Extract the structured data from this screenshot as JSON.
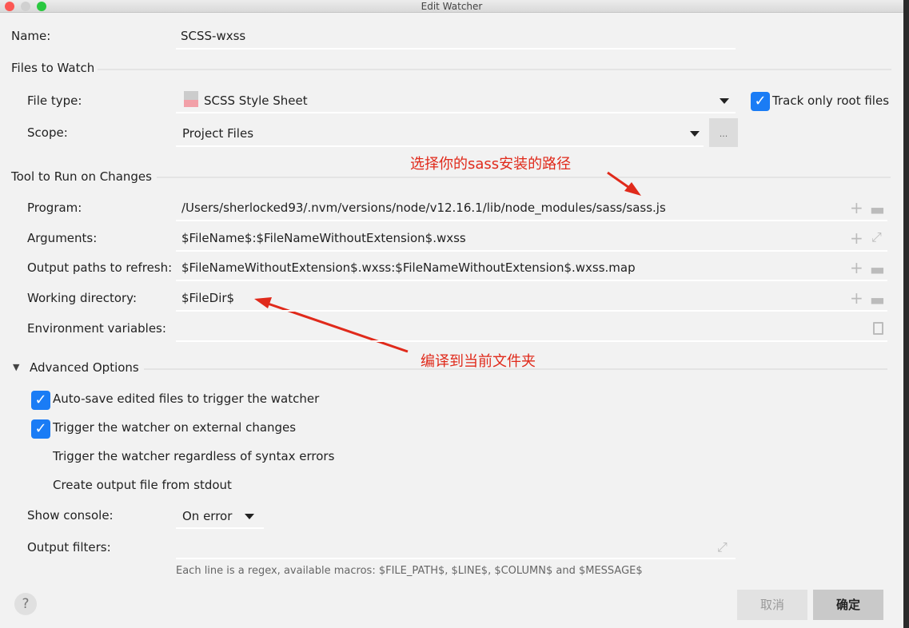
{
  "window": {
    "title": "Edit Watcher"
  },
  "name": {
    "label": "Name:",
    "value": "SCSS-wxss"
  },
  "files_to_watch": {
    "heading": "Files to Watch",
    "file_type_label": "File type:",
    "file_type_value": "SCSS Style Sheet",
    "file_type_icon_text": "SASS",
    "scope_label": "Scope:",
    "scope_value": "Project Files",
    "scope_more": "...",
    "track_root_label": "Track only root files",
    "track_root_checked": true
  },
  "tool": {
    "heading": "Tool to Run on Changes",
    "program_label": "Program:",
    "program_value": "/Users/sherlocked93/.nvm/versions/node/v12.16.1/lib/node_modules/sass/sass.js",
    "arguments_label": "Arguments:",
    "arguments_value": "$FileName$:$FileNameWithoutExtension$.wxss",
    "output_label": "Output paths to refresh:",
    "output_value": "$FileNameWithoutExtension$.wxss:$FileNameWithoutExtension$.wxss.map",
    "workdir_label": "Working directory:",
    "workdir_value": "$FileDir$",
    "env_label": "Environment variables:",
    "env_value": ""
  },
  "annotations": {
    "sass_path": "选择你的sass安装的路径",
    "current_folder": "编译到当前文件夹",
    "color": "#e02a1b"
  },
  "advanced": {
    "heading": "Advanced Options",
    "options": [
      {
        "label": "Auto-save edited files to trigger the watcher",
        "checked": true
      },
      {
        "label": "Trigger the watcher on external changes",
        "checked": true
      },
      {
        "label": "Trigger the watcher regardless of syntax errors",
        "checked": false
      },
      {
        "label": "Create output file from stdout",
        "checked": false
      }
    ],
    "show_console_label": "Show console:",
    "show_console_value": "On error",
    "output_filters_label": "Output filters:",
    "output_filters_value": "",
    "hint": "Each line is a regex, available macros: $FILE_PATH$, $LINE$, $COLUMN$ and $MESSAGE$"
  },
  "footer": {
    "help": "?",
    "cancel": "取消",
    "ok": "确定"
  }
}
